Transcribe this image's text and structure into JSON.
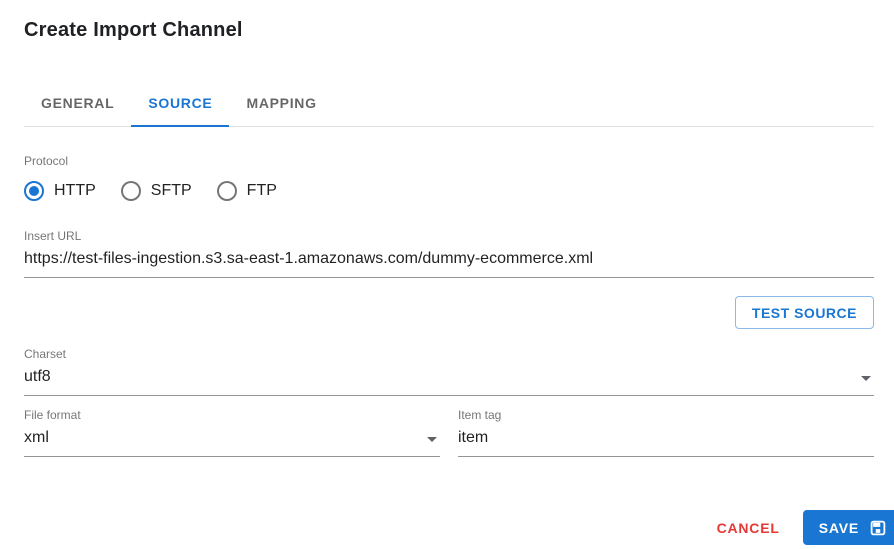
{
  "title": "Create Import Channel",
  "tabs": [
    {
      "label": "GENERAL",
      "active": false
    },
    {
      "label": "SOURCE",
      "active": true
    },
    {
      "label": "MAPPING",
      "active": false
    }
  ],
  "protocol": {
    "label": "Protocol",
    "options": [
      {
        "label": "HTTP",
        "selected": true
      },
      {
        "label": "SFTP",
        "selected": false
      },
      {
        "label": "FTP",
        "selected": false
      }
    ]
  },
  "fields": {
    "insert_url": {
      "label": "Insert URL",
      "value": "https://test-files-ingestion.s3.sa-east-1.amazonaws.com/dummy-ecommerce.xml"
    },
    "charset": {
      "label": "Charset",
      "value": "utf8"
    },
    "file_format": {
      "label": "File format",
      "value": "xml"
    },
    "item_tag": {
      "label": "Item tag",
      "value": "item"
    }
  },
  "buttons": {
    "test_source": "TEST SOURCE",
    "cancel": "CANCEL",
    "save": "SAVE"
  },
  "icons": {
    "dropdown_arrow": "triangle-down",
    "save": "floppy-disk"
  },
  "colors": {
    "primary": "#1976d2",
    "danger": "#e53935"
  }
}
